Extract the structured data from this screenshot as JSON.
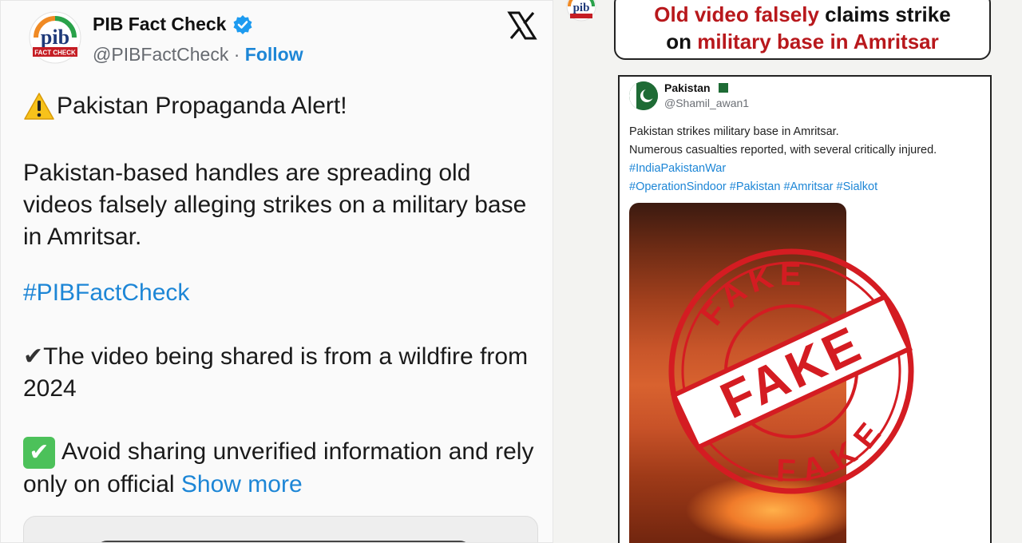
{
  "tweet": {
    "author_name": "PIB Fact Check",
    "author_handle": "@PIBFactCheck",
    "separator": "·",
    "follow_label": "Follow",
    "avatar_logo_text": "pib",
    "avatar_logo_subtext": "FACT CHECK",
    "alert_text": "Pakistan Propaganda Alert!",
    "claim_text": "Pakistan-based handles are spreading old videos falsely alleging strikes on a military base in Amritsar.",
    "hashtag": "#PIBFactCheck",
    "video_text": "The video being shared is from a wildfire from 2024",
    "avoid_text": "Avoid sharing unverified information and rely only on official",
    "show_more_label": "Show more",
    "check_mark": "✔",
    "check_box": "✔",
    "warning_icon": "warning-icon",
    "platform_icon": "x-logo-icon"
  },
  "factcheck": {
    "headline_part1_red": "Old video falsely",
    "headline_part1_dark": "claims strike",
    "headline_part2_dark": "on",
    "headline_part2_red": "military base in Amritsar",
    "shared_post": {
      "author_name": "Pakistan",
      "author_handle": "@Shamil_awan1",
      "line1": "Pakistan strikes military base in Amritsar.",
      "line2": "Numerous casualties reported, with several critically injured.",
      "hashtags_line1": "#IndiaPakistanWar",
      "hashtags_line2": "#OperationSindoor #Pakistan #Amritsar #Sialkot"
    },
    "stamp_word": "FAKE"
  },
  "colors": {
    "link_blue": "#1d86d6",
    "stamp_red": "#d41c22",
    "headline_red": "#b8181c",
    "verified_blue": "#1d9bf0",
    "check_green": "#4cc15a"
  }
}
